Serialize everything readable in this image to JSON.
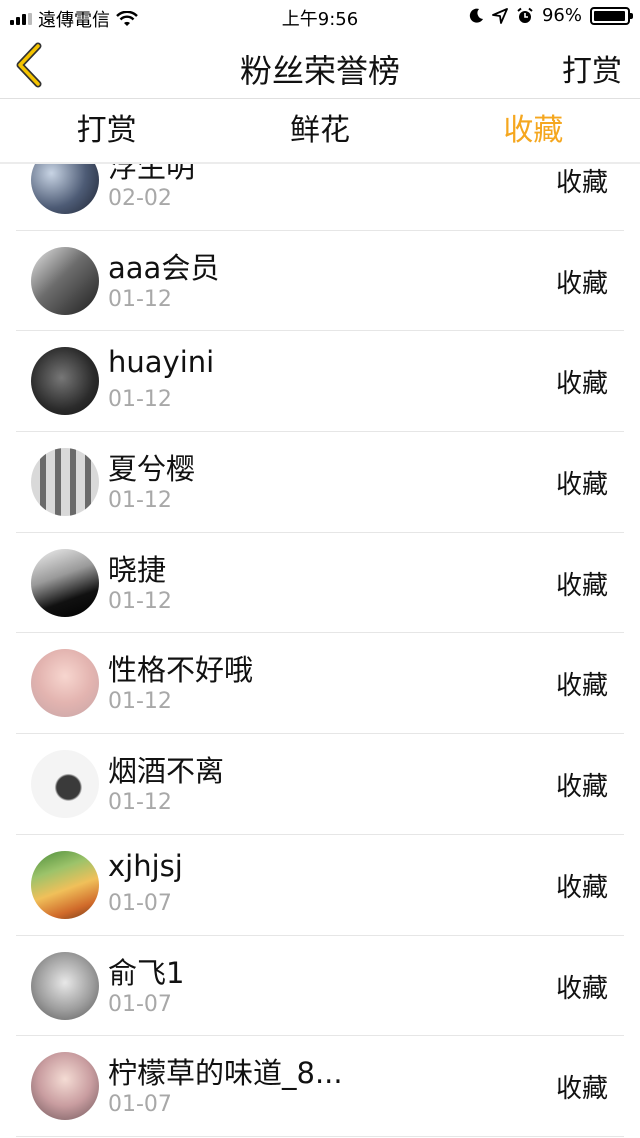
{
  "status_bar": {
    "carrier": "遠傳電信",
    "time": "上午9:56",
    "battery": "96%",
    "battery_level": 0.96
  },
  "nav": {
    "title": "粉丝荣誉榜",
    "right_label": "打赏"
  },
  "tabs": [
    {
      "label": "打赏",
      "active": false
    },
    {
      "label": "鲜花",
      "active": false
    },
    {
      "label": "收藏",
      "active": true
    }
  ],
  "accent_color": "#f5a71f",
  "list": [
    {
      "name": "浮生明",
      "date": "02-02",
      "action": "收藏"
    },
    {
      "name": "aaa会员",
      "date": "01-12",
      "action": "收藏"
    },
    {
      "name": "huayini",
      "date": "01-12",
      "action": "收藏"
    },
    {
      "name": "夏兮樱",
      "date": "01-12",
      "action": "收藏"
    },
    {
      "name": "晓捷",
      "date": "01-12",
      "action": "收藏"
    },
    {
      "name": "性格不好哦",
      "date": "01-12",
      "action": "收藏"
    },
    {
      "name": "烟酒不离",
      "date": "01-12",
      "action": "收藏"
    },
    {
      "name": "xjhjsj",
      "date": "01-07",
      "action": "收藏"
    },
    {
      "name": "俞飞1",
      "date": "01-07",
      "action": "收藏"
    },
    {
      "name": "柠檬草的味道_8...",
      "date": "01-07",
      "action": "收藏"
    }
  ]
}
